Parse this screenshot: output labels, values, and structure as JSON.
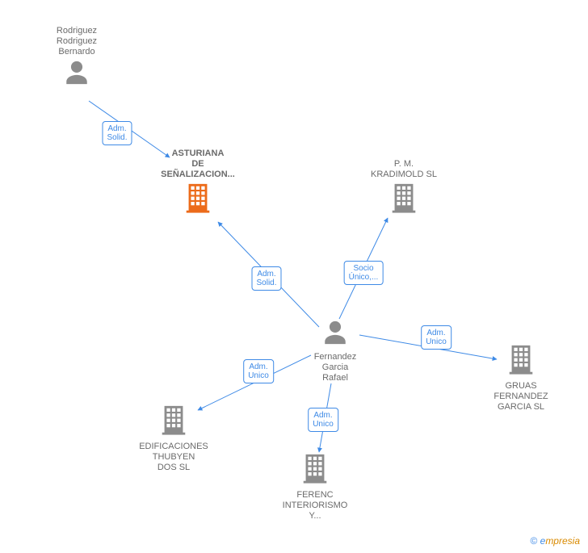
{
  "nodes": {
    "person_rrb": {
      "label": "Rodriguez\nRodriguez\nBernardo"
    },
    "person_fgr": {
      "label": "Fernandez\nGarcia\nRafael"
    },
    "org_ast": {
      "label": "ASTURIANA\nDE\nSEÑALIZACION..."
    },
    "org_pmk": {
      "label": "P. M.\nKRADIMOLD SL"
    },
    "org_gruas": {
      "label": "GRUAS\nFERNANDEZ\nGARCIA SL"
    },
    "org_ferenc": {
      "label": "FERENC\nINTERIORISMO\nY..."
    },
    "org_edif": {
      "label": "EDIFICACIONES\nTHUBYEN\nDOS SL"
    }
  },
  "edges": {
    "e_rrb_ast": {
      "label": "Adm.\nSolid."
    },
    "e_fgr_ast": {
      "label": "Adm.\nSolid."
    },
    "e_fgr_pmk": {
      "label": "Socio\nÚnico,..."
    },
    "e_fgr_gruas": {
      "label": "Adm.\nUnico"
    },
    "e_fgr_ferenc": {
      "label": "Adm.\nUnico"
    },
    "e_fgr_edif": {
      "label": "Adm.\nUnico"
    }
  },
  "footer": {
    "copyright": "©",
    "brand_e": "e",
    "brand_rest": "mpresia"
  },
  "colors": {
    "line": "#3e8ae6",
    "person": "#8c8c8c",
    "building": "#8c8c8c",
    "building_hl": "#ec6b1a"
  }
}
